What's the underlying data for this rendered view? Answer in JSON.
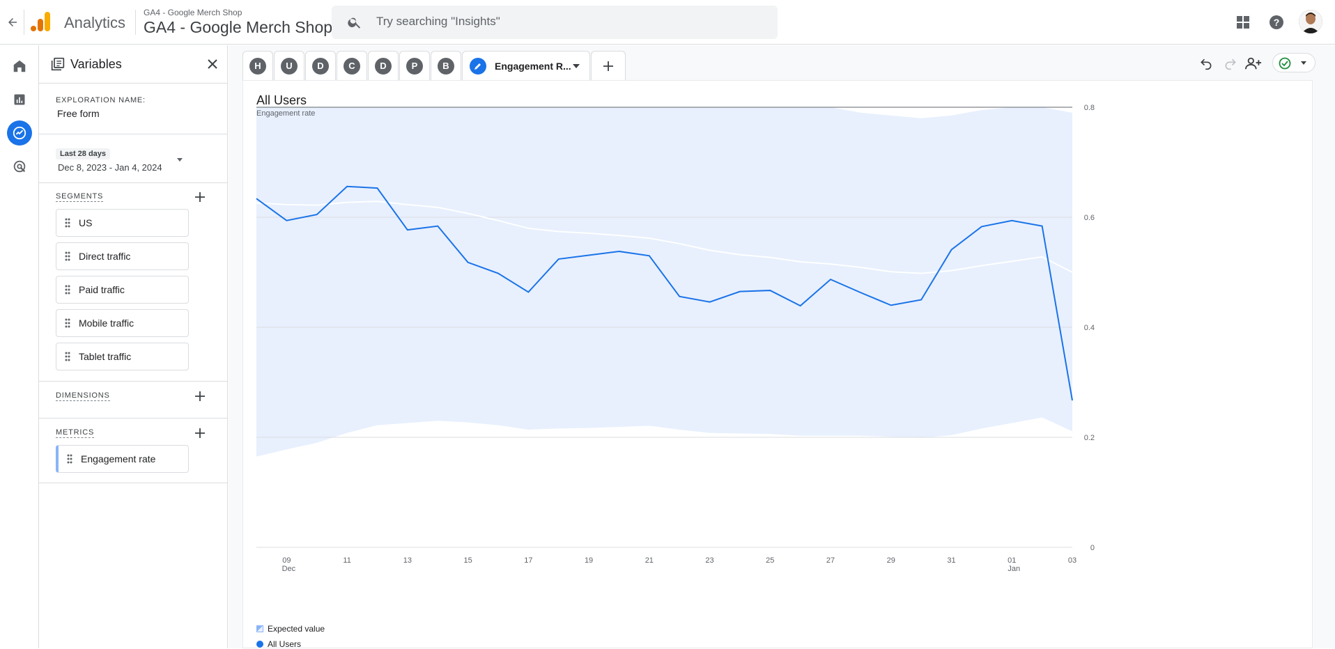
{
  "header": {
    "app_name": "Analytics",
    "property_small": "GA4 - Google Merch Shop",
    "property_large": "GA4 - Google Merch Shop",
    "search_placeholder": "Try searching \"Insights\""
  },
  "variables": {
    "title": "Variables",
    "exploration_name_label": "EXPLORATION NAME:",
    "exploration_name": "Free form",
    "date_preset": "Last 28 days",
    "date_range": "Dec 8, 2023 - Jan 4, 2024",
    "segments_label": "SEGMENTS",
    "segments": [
      "US",
      "Direct traffic",
      "Paid traffic",
      "Mobile traffic",
      "Tablet traffic"
    ],
    "dimensions_label": "DIMENSIONS",
    "metrics_label": "METRICS",
    "metrics": [
      "Engagement rate"
    ]
  },
  "tabs": {
    "items": [
      "H",
      "U",
      "D",
      "C",
      "D",
      "P",
      "B"
    ],
    "active_label": "Engagement R..."
  },
  "chart_data": {
    "type": "line",
    "title": "All Users",
    "subtitle": "Engagement rate",
    "ylim": [
      0,
      0.8
    ],
    "y_ticks": [
      "0.8",
      "0.6",
      "0.4",
      "0.2",
      "0"
    ],
    "x_ticks": [
      {
        "day": "09",
        "month": "Dec"
      },
      {
        "day": "11",
        "month": ""
      },
      {
        "day": "13",
        "month": ""
      },
      {
        "day": "15",
        "month": ""
      },
      {
        "day": "17",
        "month": ""
      },
      {
        "day": "19",
        "month": ""
      },
      {
        "day": "21",
        "month": ""
      },
      {
        "day": "23",
        "month": ""
      },
      {
        "day": "25",
        "month": ""
      },
      {
        "day": "27",
        "month": ""
      },
      {
        "day": "29",
        "month": ""
      },
      {
        "day": "31",
        "month": ""
      },
      {
        "day": "01",
        "month": "Jan"
      },
      {
        "day": "03",
        "month": ""
      }
    ],
    "x": [
      "Dec 8",
      "Dec 9",
      "Dec 10",
      "Dec 11",
      "Dec 12",
      "Dec 13",
      "Dec 14",
      "Dec 15",
      "Dec 16",
      "Dec 17",
      "Dec 18",
      "Dec 19",
      "Dec 20",
      "Dec 21",
      "Dec 22",
      "Dec 23",
      "Dec 24",
      "Dec 25",
      "Dec 26",
      "Dec 27",
      "Dec 28",
      "Dec 29",
      "Dec 30",
      "Dec 31",
      "Jan 1",
      "Jan 2",
      "Jan 3",
      "Jan 4"
    ],
    "series": [
      {
        "name": "All Users",
        "color": "#1a73e8",
        "values": [
          0.634,
          0.594,
          0.605,
          0.656,
          0.653,
          0.577,
          0.584,
          0.518,
          0.498,
          0.464,
          0.524,
          0.531,
          0.538,
          0.53,
          0.456,
          0.446,
          0.465,
          0.467,
          0.439,
          0.487,
          0.463,
          0.44,
          0.45,
          0.541,
          0.583,
          0.594,
          0.584,
          0.267
        ]
      },
      {
        "name": "Expected value",
        "color": "#ffffff",
        "values": [
          0.626,
          0.623,
          0.622,
          0.627,
          0.629,
          0.623,
          0.618,
          0.607,
          0.594,
          0.58,
          0.574,
          0.571,
          0.567,
          0.562,
          0.552,
          0.54,
          0.532,
          0.527,
          0.519,
          0.515,
          0.509,
          0.501,
          0.498,
          0.503,
          0.512,
          0.52,
          0.528,
          0.5
        ]
      }
    ],
    "band_upper": [
      0.8,
      0.8,
      0.8,
      0.8,
      0.8,
      0.8,
      0.8,
      0.8,
      0.8,
      0.8,
      0.8,
      0.8,
      0.8,
      0.8,
      0.8,
      0.8,
      0.8,
      0.8,
      0.8,
      0.8,
      0.79,
      0.785,
      0.78,
      0.785,
      0.795,
      0.8,
      0.8,
      0.79
    ],
    "band_lower": [
      0.165,
      0.178,
      0.19,
      0.208,
      0.222,
      0.226,
      0.23,
      0.227,
      0.222,
      0.214,
      0.216,
      0.217,
      0.219,
      0.221,
      0.214,
      0.208,
      0.207,
      0.206,
      0.203,
      0.203,
      0.203,
      0.201,
      0.199,
      0.204,
      0.216,
      0.226,
      0.236,
      0.211
    ],
    "legend": [
      "Expected value",
      "All Users"
    ],
    "band_color": "#e8f0fe"
  }
}
